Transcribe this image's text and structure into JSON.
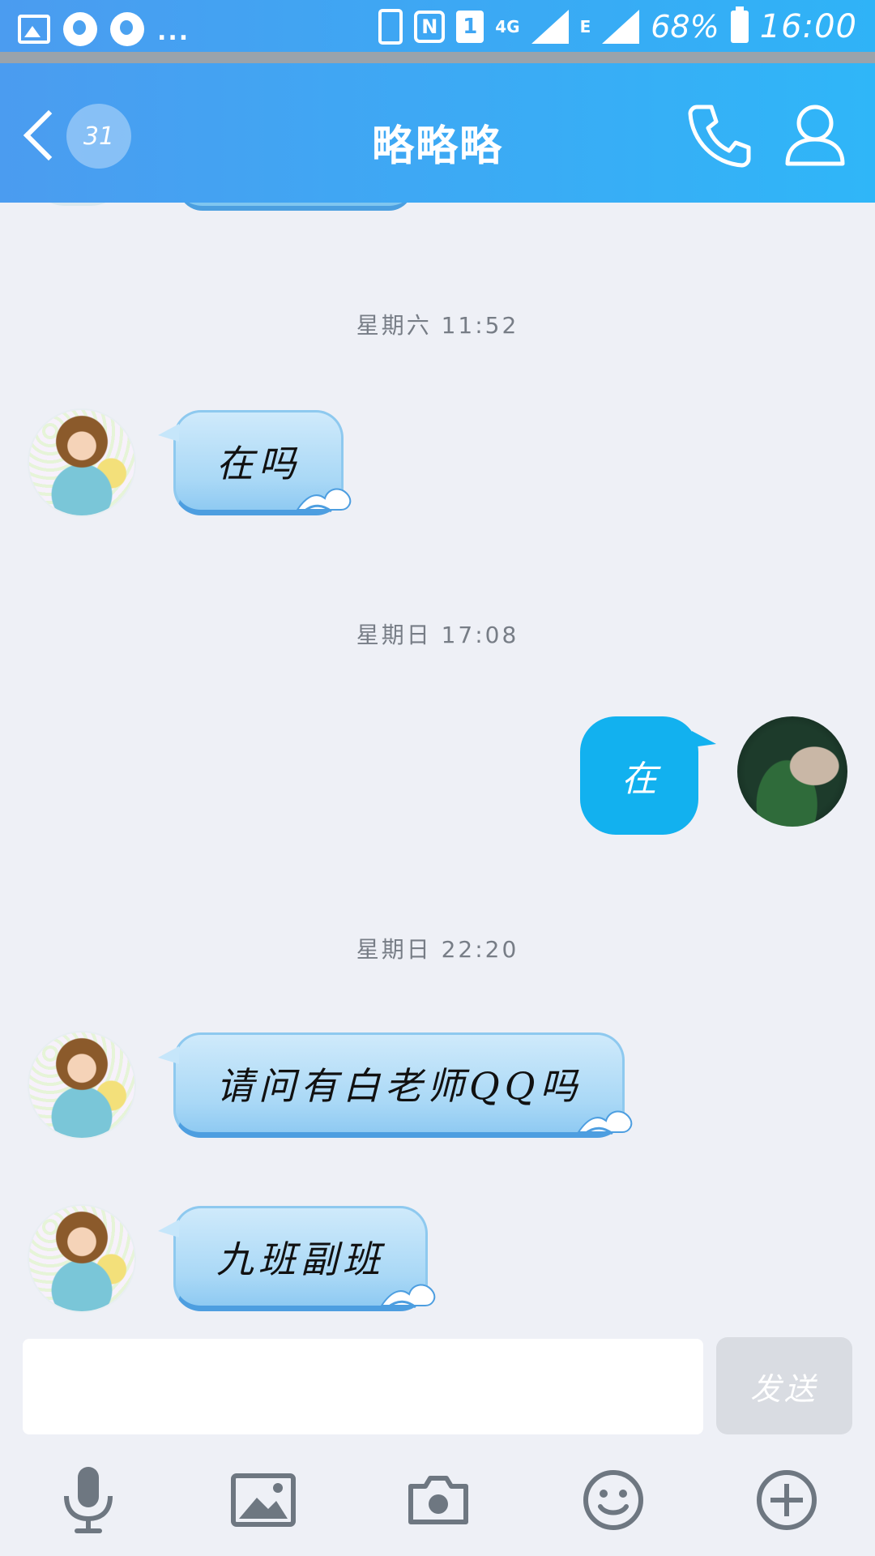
{
  "status_bar": {
    "more": "...",
    "nfc": "N",
    "sim": "1",
    "network": "4G",
    "signal_type": "E",
    "battery": "68%",
    "time": "16:00"
  },
  "title_bar": {
    "unread_count": "31",
    "title": "略略略"
  },
  "messages": [
    {
      "type": "timestamp",
      "text": "星期六 11:52"
    },
    {
      "type": "incoming",
      "text": "在吗"
    },
    {
      "type": "timestamp",
      "text": "星期日 17:08"
    },
    {
      "type": "outgoing",
      "text": "在"
    },
    {
      "type": "timestamp",
      "text": "星期日 22:20"
    },
    {
      "type": "incoming",
      "text": "请问有白老师QQ吗"
    },
    {
      "type": "incoming",
      "text": "九班副班"
    }
  ],
  "composer": {
    "input_value": "",
    "send_label": "发送"
  },
  "colors": {
    "header_start": "#4b9cf0",
    "header_end": "#2fb6f8",
    "outgoing_bubble": "#12b1ef",
    "incoming_bubble": "#a9d8f6",
    "background": "#eef0f6"
  },
  "icons": [
    "back-chevron-icon",
    "phone-icon",
    "profile-icon",
    "microphone-icon",
    "image-icon",
    "camera-icon",
    "emoji-icon",
    "plus-icon"
  ]
}
